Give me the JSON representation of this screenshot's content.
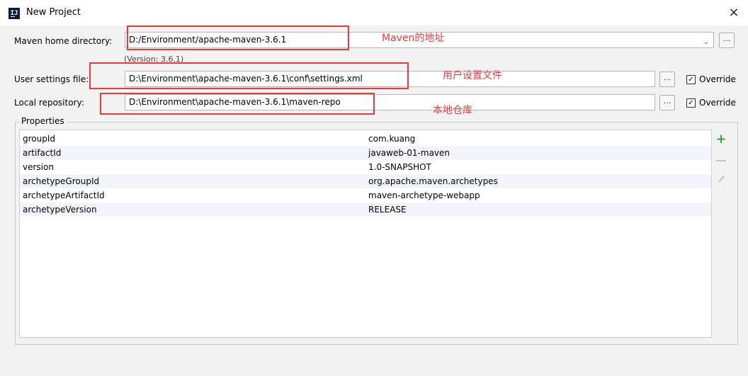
{
  "window": {
    "title": "New Project",
    "close": "×",
    "app_icon": "IJ"
  },
  "maven_home": {
    "label": "Maven home directory:",
    "value": "D:/Environment/apache-maven-3.6.1",
    "version": "(Version: 3.6.1)",
    "annotation": "Maven的地址",
    "browse": "..."
  },
  "user_settings": {
    "label": "User settings file:",
    "value": "D:\\Environment\\apache-maven-3.6.1\\conf\\settings.xml",
    "annotation": "用户设置文件",
    "browse": "...",
    "override_label": "Override",
    "override_checked": true
  },
  "local_repo": {
    "label": "Local repository:",
    "value": "D:\\Environment\\apache-maven-3.6.1\\maven-repo",
    "annotation": "本地仓库",
    "browse": "...",
    "override_label": "Override",
    "override_checked": true
  },
  "properties": {
    "title": "Properties",
    "rows": [
      {
        "key": "groupId",
        "value": "com.kuang"
      },
      {
        "key": "artifactId",
        "value": "javaweb-01-maven"
      },
      {
        "key": "version",
        "value": "1.0-SNAPSHOT"
      },
      {
        "key": "archetypeGroupId",
        "value": "org.apache.maven.archetypes"
      },
      {
        "key": "archetypeArtifactId",
        "value": "maven-archetype-webapp"
      },
      {
        "key": "archetypeVersion",
        "value": "RELEASE"
      }
    ],
    "add_icon": "+"
  },
  "colors": {
    "annotation": "#e83b3b",
    "add": "#3a9f3a",
    "row_alt": "#f2f5fb"
  }
}
